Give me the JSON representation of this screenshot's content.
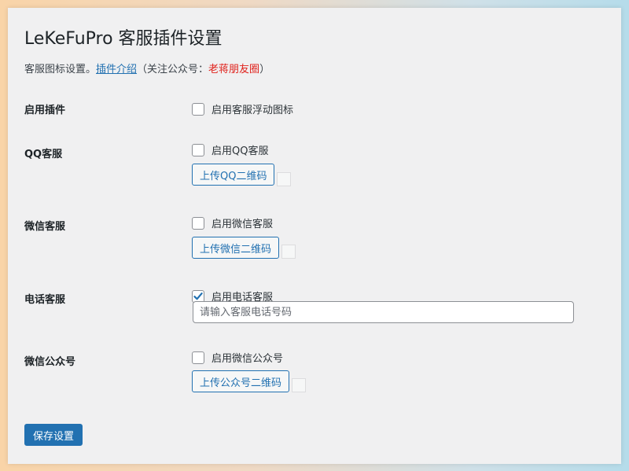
{
  "page": {
    "title": "LeKeFuPro 客服插件设置",
    "description_prefix": "客服图标设置。",
    "description_link": "插件介绍",
    "description_middle": "（关注公众号：",
    "description_highlight": "老蒋朋友圈",
    "description_suffix": "）"
  },
  "settings": {
    "plugin": {
      "label": "启用插件",
      "checkbox_label": "启用客服浮动图标",
      "checked": false
    },
    "qq": {
      "label": "QQ客服",
      "checkbox_label": "启用QQ客服",
      "checked": false,
      "upload_label": "上传QQ二维码"
    },
    "wechat": {
      "label": "微信客服",
      "checkbox_label": "启用微信客服",
      "checked": false,
      "upload_label": "上传微信二维码"
    },
    "phone": {
      "label": "电话客服",
      "checkbox_label": "启用电话客服",
      "checked": true,
      "input_placeholder": "请输入客服电话号码",
      "input_value": ""
    },
    "official_account": {
      "label": "微信公众号",
      "checkbox_label": "启用微信公众号",
      "checked": false,
      "upload_label": "上传公众号二维码"
    }
  },
  "actions": {
    "save_label": "保存设置"
  },
  "colors": {
    "accent": "#2271b1",
    "highlight_red": "#e0201a",
    "panel_bg": "#f0f0f1"
  }
}
